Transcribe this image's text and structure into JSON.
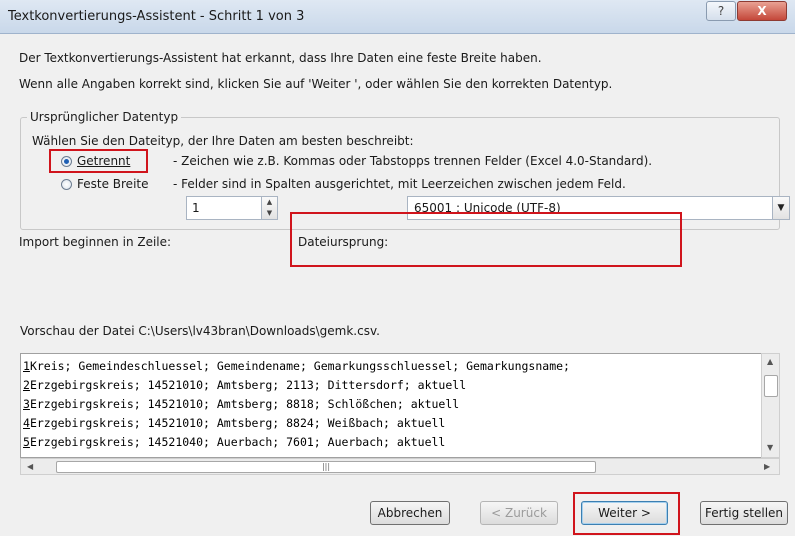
{
  "window": {
    "title": "Textkonvertierungs-Assistent - Schritt 1 von 3",
    "help_label": "?",
    "close_label": "X"
  },
  "intro": {
    "line1": "Der Textkonvertierungs-Assistent hat erkannt, dass Ihre Daten eine feste Breite haben.",
    "line2": "Wenn alle Angaben korrekt sind, klicken Sie auf 'Weiter ', oder wählen Sie den korrekten Datentyp."
  },
  "datatype_group": {
    "legend": "Ursprünglicher Datentyp",
    "prompt": "Wählen Sie den Dateityp, der Ihre Daten am besten beschreibt:",
    "options": [
      {
        "label": "Getrennt",
        "description": "- Zeichen wie z.B. Kommas oder Tabstopps trennen Felder (Excel 4.0-Standard).",
        "selected": true
      },
      {
        "label": "Feste Breite",
        "description": "- Felder sind in Spalten ausgerichtet, mit Leerzeichen zwischen jedem Feld.",
        "selected": false
      }
    ]
  },
  "import_start": {
    "label": "Import beginnen in Zeile:",
    "value": "1"
  },
  "file_origin": {
    "label": "Dateiursprung:",
    "value": "65001 : Unicode (UTF-8)"
  },
  "preview": {
    "label": "Vorschau der Datei C:\\Users\\lv43bran\\Downloads\\gemk.csv.",
    "lines": [
      {
        "num": "1",
        "text": "Kreis; Gemeindeschluessel; Gemeindename; Gemarkungsschluessel; Gemarkungsname;"
      },
      {
        "num": "2",
        "text": "Erzgebirgskreis; 14521010; Amtsberg; 2113; Dittersdorf; aktuell"
      },
      {
        "num": "3",
        "text": "Erzgebirgskreis; 14521010; Amtsberg; 8818; Schlößchen; aktuell"
      },
      {
        "num": "4",
        "text": "Erzgebirgskreis; 14521010; Amtsberg; 8824; Weißbach; aktuell"
      },
      {
        "num": "5",
        "text": "Erzgebirgskreis; 14521040; Auerbach; 7601; Auerbach; aktuell"
      }
    ]
  },
  "buttons": {
    "cancel": "Abbrechen",
    "back": "< Zurück",
    "next": "Weiter >",
    "finish": "Fertig stellen"
  },
  "colors": {
    "highlight_box": "#d0141c",
    "dialog_background": "#f0f0f0"
  }
}
